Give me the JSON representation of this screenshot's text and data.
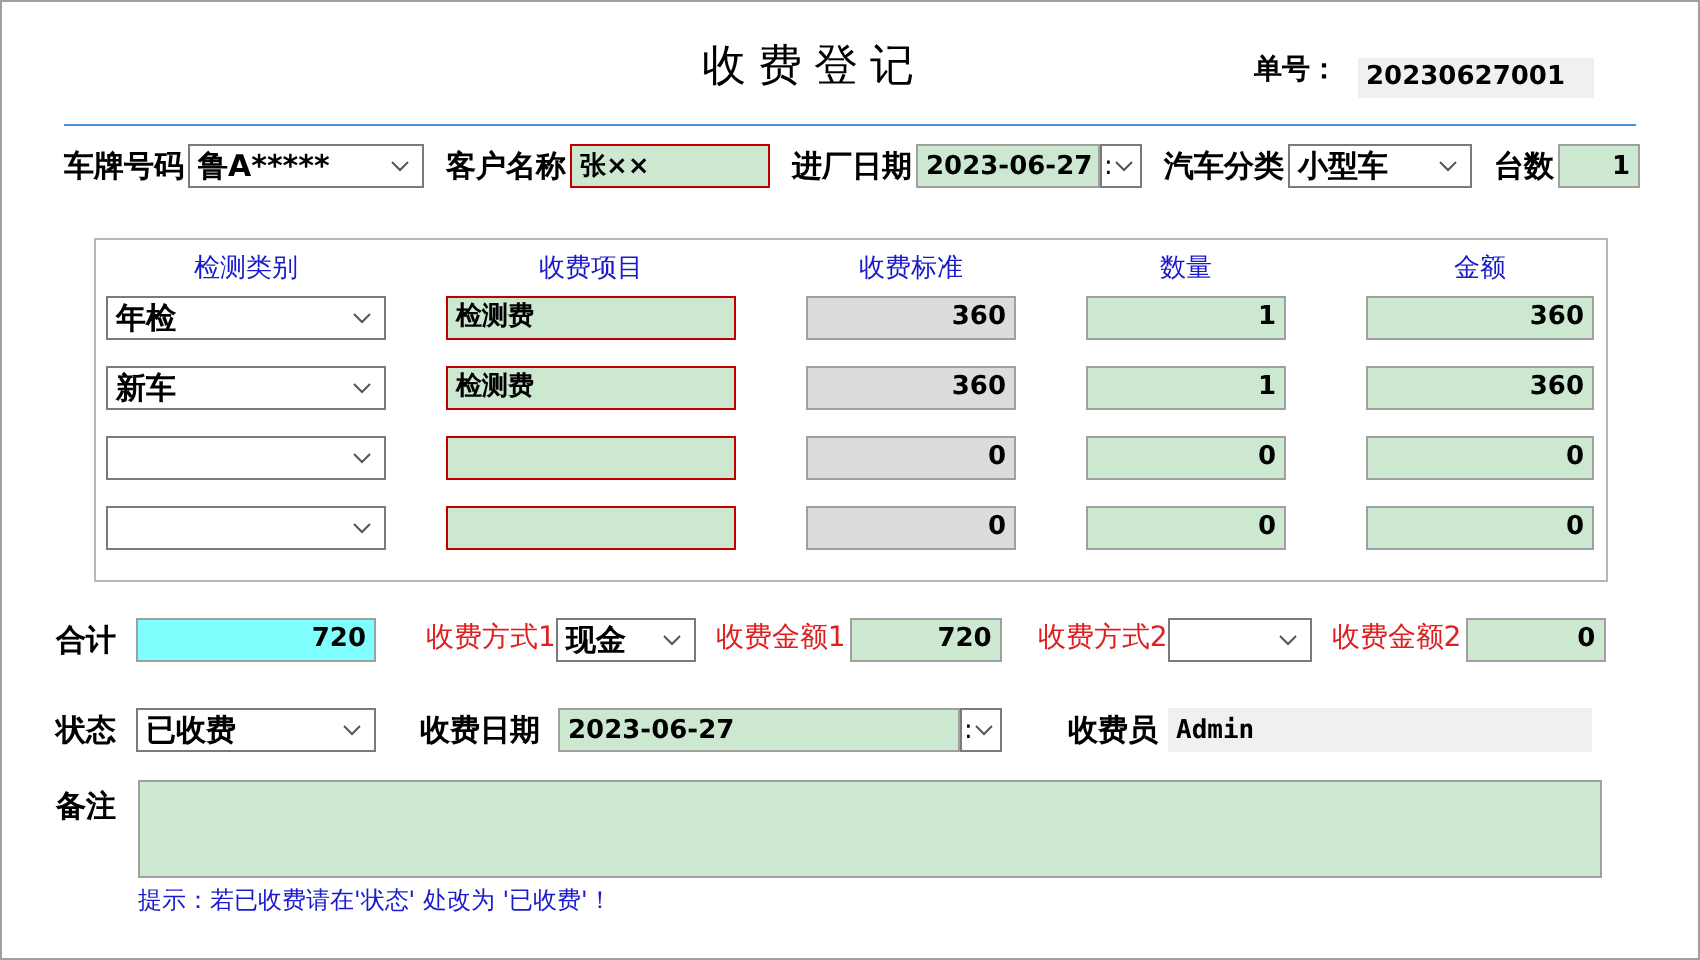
{
  "title": "收费登记",
  "order": {
    "label": "单号：",
    "value": "20230627001"
  },
  "header_fields": [
    {
      "label": "车牌号码",
      "kind": "select",
      "value": "鲁A*****"
    },
    {
      "label": "客户名称",
      "kind": "text",
      "value": "张××",
      "required": true
    },
    {
      "label": "进厂日期",
      "kind": "date",
      "value": "2023-06-27",
      "spin": ":"
    },
    {
      "label": "汽车分类",
      "kind": "select",
      "value": "小型车"
    },
    {
      "label": "台数",
      "kind": "number",
      "value": "1"
    }
  ],
  "table": {
    "columns": [
      "检测类别",
      "收费项目",
      "收费标准",
      "数量",
      "金额"
    ],
    "rows": [
      {
        "category": "年检",
        "item": "检测费",
        "standard": "360",
        "quantity": "1",
        "amount": "360"
      },
      {
        "category": "新车",
        "item": "检测费",
        "standard": "360",
        "quantity": "1",
        "amount": "360"
      },
      {
        "standard": "0",
        "quantity": "0",
        "amount": "0"
      },
      {
        "standard": "0",
        "quantity": "0",
        "amount": "0"
      }
    ]
  },
  "total": {
    "label": "合计",
    "value": "720"
  },
  "payments": [
    {
      "method_label": "收费方式1",
      "method": "现金",
      "amount_label": "收费金额1",
      "amount": "720"
    },
    {
      "method_label": "收费方式2",
      "amount_label": "收费金额2",
      "amount": "0"
    }
  ],
  "status": {
    "label": "状态",
    "value": "已收费"
  },
  "charge_date": {
    "label": "收费日期",
    "value": "2023-06-27",
    "spin": ":"
  },
  "cashier": {
    "label": "收费员",
    "value": "Admin"
  },
  "remark": {
    "label": "备注"
  },
  "hint": "提示：若已收费请在'状态' 处改为 '已收费'！"
}
